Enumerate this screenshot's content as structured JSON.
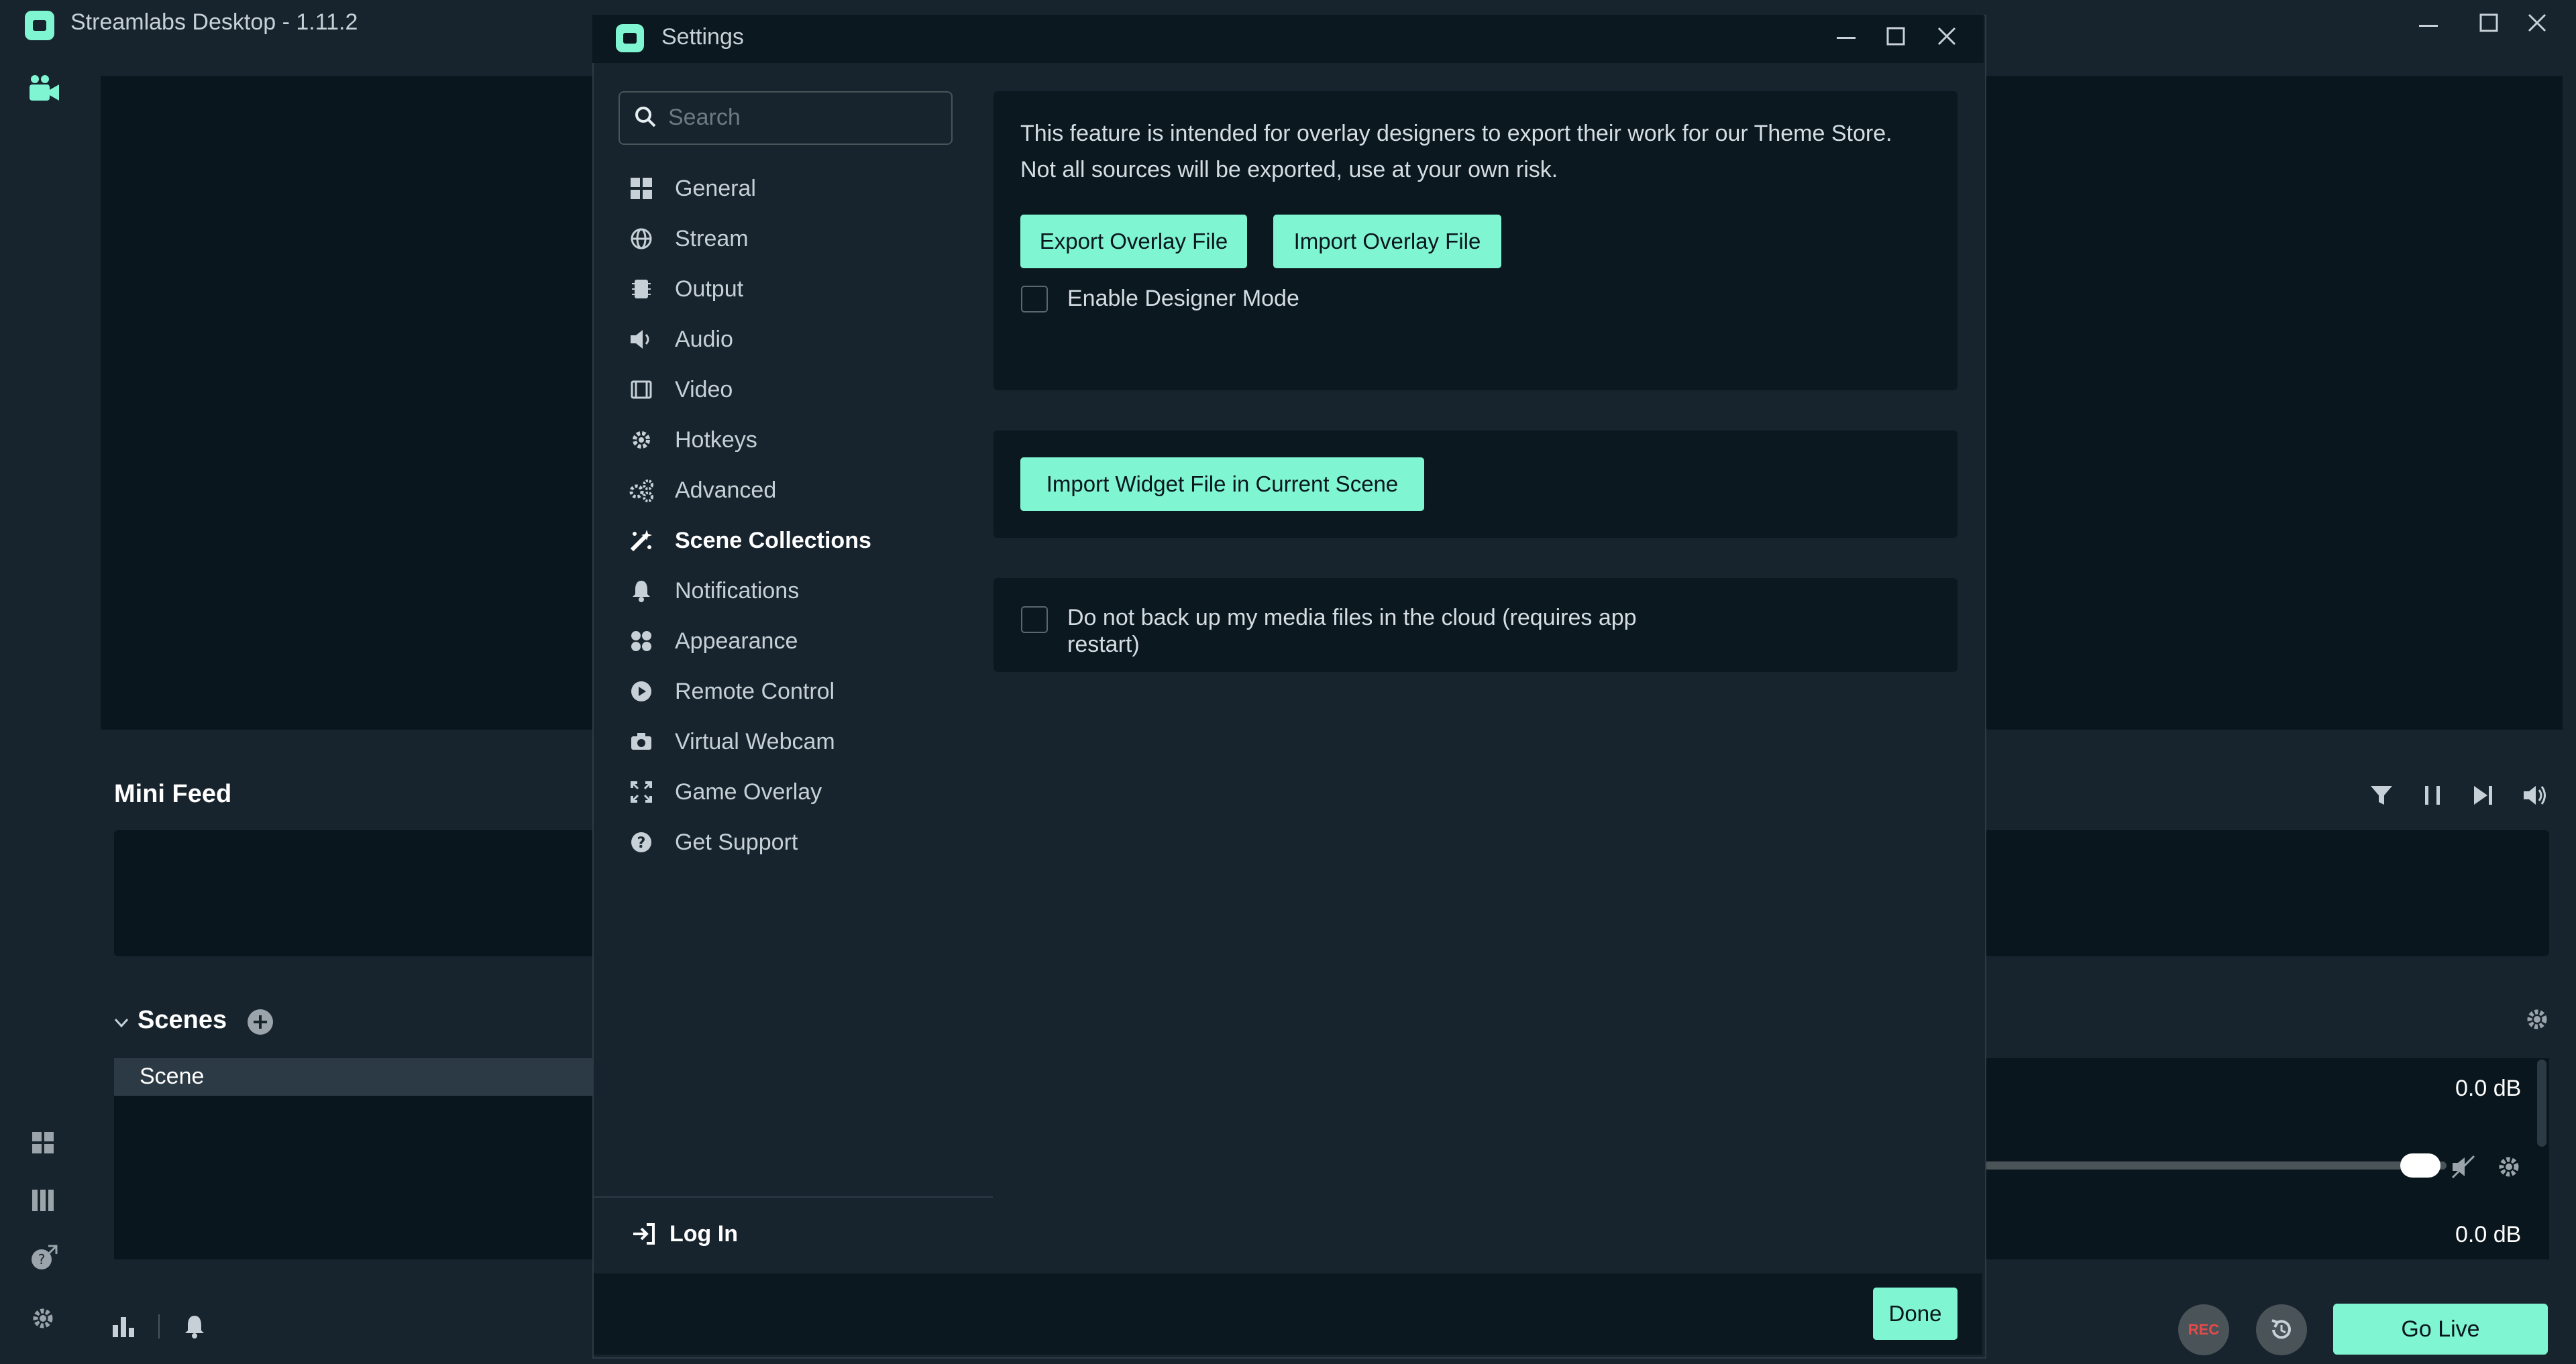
{
  "app": {
    "title": "Streamlabs Desktop - 1.11.2",
    "accent_color": "#80f5d2",
    "background_color": "#09161d"
  },
  "main": {
    "mini_feed_title": "Mini Feed",
    "scenes_title": "Scenes",
    "scene_item": "Scene",
    "mixer_levels": [
      "0.0 dB",
      "0.0 dB"
    ],
    "rec_label": "REC",
    "go_live_label": "Go Live"
  },
  "settings": {
    "title": "Settings",
    "search_placeholder": "Search",
    "nav": [
      {
        "label": "General",
        "icon": "grid-icon"
      },
      {
        "label": "Stream",
        "icon": "globe-icon"
      },
      {
        "label": "Output",
        "icon": "chip-icon"
      },
      {
        "label": "Audio",
        "icon": "speaker-icon"
      },
      {
        "label": "Video",
        "icon": "film-icon"
      },
      {
        "label": "Hotkeys",
        "icon": "gear-icon"
      },
      {
        "label": "Advanced",
        "icon": "gears-icon"
      },
      {
        "label": "Scene Collections",
        "icon": "magic-icon"
      },
      {
        "label": "Notifications",
        "icon": "bell-icon"
      },
      {
        "label": "Appearance",
        "icon": "palette-icon"
      },
      {
        "label": "Remote Control",
        "icon": "play-circle-icon"
      },
      {
        "label": "Virtual Webcam",
        "icon": "camera-icon"
      },
      {
        "label": "Game Overlay",
        "icon": "expand-icon"
      },
      {
        "label": "Get Support",
        "icon": "question-icon"
      }
    ],
    "active_nav": "Scene Collections",
    "login_label": "Log In",
    "overlay_card": {
      "description_line1": "This feature is intended for overlay designers to export their work for our Theme Store.",
      "description_line2": "Not all sources will be exported, use at your own risk.",
      "export_button": "Export Overlay File",
      "import_button": "Import Overlay File",
      "designer_mode_label": "Enable Designer Mode",
      "designer_mode_checked": false
    },
    "widget_card": {
      "import_widget_button": "Import Widget File in Current Scene"
    },
    "backup_card": {
      "label_line1": "Do not back up my media files in the cloud (requires app",
      "label_line2": "restart)",
      "checked": false
    },
    "done_label": "Done"
  }
}
